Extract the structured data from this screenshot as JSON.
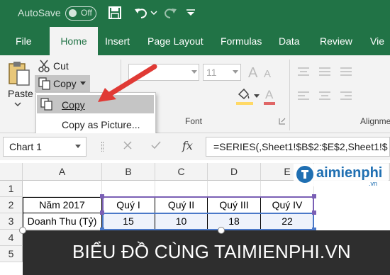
{
  "titlebar": {
    "autosave_label": "AutoSave",
    "autosave_state": "Off"
  },
  "tabs": [
    "File",
    "Home",
    "Insert",
    "Page Layout",
    "Formulas",
    "Data",
    "Review",
    "Vie"
  ],
  "clipboard": {
    "paste_label": "Paste",
    "cut_label": "Cut",
    "copy_label": "Copy",
    "menu_copy": "Copy",
    "menu_copy_as_picture": "Copy as Picture..."
  },
  "font": {
    "size_value": "11",
    "group_label": "Font"
  },
  "alignment": {
    "group_label": "Alignme"
  },
  "formula_bar": {
    "name_box": "Chart 1",
    "fx": "fx",
    "formula": "=SERIES(,Sheet1!$B$2:$E$2,Sheet1!$"
  },
  "columns": [
    "A",
    "B",
    "C",
    "D",
    "E"
  ],
  "rows": [
    "1",
    "2",
    "3",
    "4",
    "5"
  ],
  "table": {
    "row2": [
      "Năm 2017",
      "Quý I",
      "Quý II",
      "Quý III",
      "Quý IV"
    ],
    "row3": [
      "Doanh Thu (Tỷ)",
      "15",
      "10",
      "18",
      "22"
    ]
  },
  "banner_text": "BIỂU ĐỒ CÙNG TAIMIENPHI.VN",
  "logo": {
    "text": "aimienphi",
    "suffix": ".vn"
  },
  "colors": {
    "excel_green": "#217346",
    "arrow": "#e03a35",
    "selection": "#7a5fb5"
  }
}
